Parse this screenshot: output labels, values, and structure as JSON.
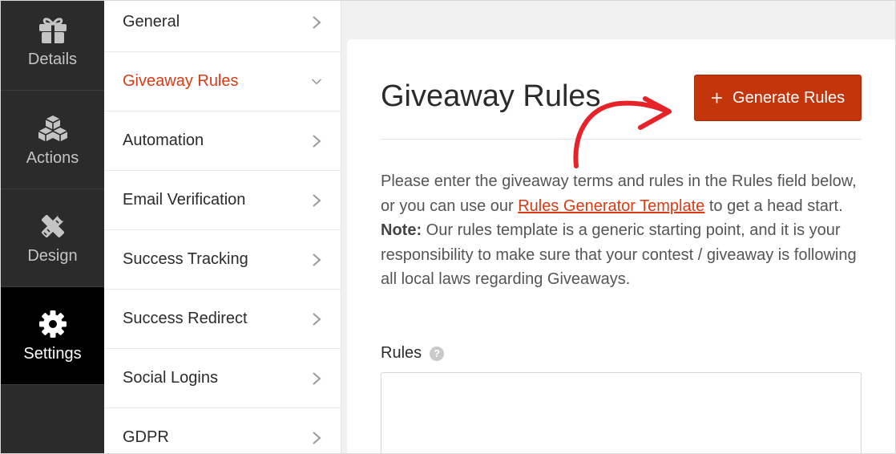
{
  "rail": {
    "items": [
      {
        "label": "Details",
        "icon": "gift-icon"
      },
      {
        "label": "Actions",
        "icon": "cubes-icon"
      },
      {
        "label": "Design",
        "icon": "pencil-ruler-icon"
      },
      {
        "label": "Settings",
        "icon": "gear-icon",
        "active": true
      }
    ]
  },
  "subnav": {
    "items": [
      {
        "label": "General"
      },
      {
        "label": "Giveaway Rules",
        "active": true
      },
      {
        "label": "Automation"
      },
      {
        "label": "Email Verification"
      },
      {
        "label": "Success Tracking"
      },
      {
        "label": "Success Redirect"
      },
      {
        "label": "Social Logins"
      },
      {
        "label": "GDPR"
      }
    ]
  },
  "main": {
    "title": "Giveaway Rules",
    "generate_button": "Generate Rules",
    "desc_part1": "Please enter the giveaway terms and rules in the Rules field below, or you can use our ",
    "desc_link": "Rules Generator Template",
    "desc_part2": " to get a head start.",
    "note_label": "Note:",
    "note_text": " Our rules template is a generic starting point, and it is your responsibility to make sure that your contest / giveaway is following all local laws regarding Giveaways.",
    "rules_label": "Rules",
    "help_glyph": "?",
    "rules_value": ""
  },
  "colors": {
    "accent": "#d93b14",
    "button": "#c3360c",
    "rail_bg": "#2b2b2b",
    "rail_active_bg": "#000000"
  }
}
